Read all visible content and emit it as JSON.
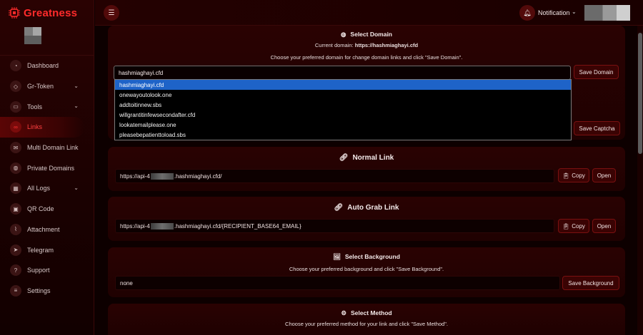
{
  "brand": {
    "name": "Greatness"
  },
  "topbar": {
    "notification_label": "Notification"
  },
  "sidebar": {
    "items": [
      {
        "label": "Dashboard",
        "icon": "dashboard-icon",
        "has_submenu": false,
        "active": false
      },
      {
        "label": "Gr-Token",
        "icon": "gem-icon",
        "has_submenu": true,
        "active": false
      },
      {
        "label": "Tools",
        "icon": "laptop-icon",
        "has_submenu": true,
        "active": false
      },
      {
        "label": "Links",
        "icon": "link-icon",
        "has_submenu": false,
        "active": true
      },
      {
        "label": "Multi Domain Link",
        "icon": "envelope-icon",
        "has_submenu": false,
        "active": false
      },
      {
        "label": "Private Domains",
        "icon": "globe-icon",
        "has_submenu": false,
        "active": false
      },
      {
        "label": "All Logs",
        "icon": "grid-icon",
        "has_submenu": true,
        "active": false
      },
      {
        "label": "QR Code",
        "icon": "qr-icon",
        "has_submenu": false,
        "active": false
      },
      {
        "label": "Attachment",
        "icon": "paperclip-icon",
        "has_submenu": false,
        "active": false
      },
      {
        "label": "Telegram",
        "icon": "telegram-icon",
        "has_submenu": false,
        "active": false
      },
      {
        "label": "Support",
        "icon": "question-icon",
        "has_submenu": false,
        "active": false
      },
      {
        "label": "Settings",
        "icon": "sliders-icon",
        "has_submenu": false,
        "active": false
      }
    ]
  },
  "select_domain": {
    "title": "Select Domain",
    "current_label": "Current domain:",
    "current_value": "https://hashmiaghayi.cfd",
    "instruction": "Choose your preferred domain for change domain links and click \"Save Domain\".",
    "selected": "hashmiaghayi.cfd",
    "options": [
      "hashmiaghayi.cfd",
      "onewayoutolook.one",
      "addtoitinnew.sbs",
      "willgrantitinfewsecondafter.cfd",
      "lookatemailplease.one",
      "pleasebepatienttoload.sbs"
    ],
    "save_label": "Save Domain",
    "save_captcha_label": "Save Captcha"
  },
  "normal_link": {
    "title": "Normal Link",
    "url_prefix": "https://api-4",
    "url_suffix": ".hashmiaghayi.cfd/",
    "copy_label": "Copy",
    "open_label": "Open"
  },
  "auto_grab_link": {
    "title": "Auto Grab Link",
    "url_prefix": "https://api-4",
    "url_suffix": ".hashmiaghayi.cfd/{RECIPIENT_BASE64_EMAIL}",
    "copy_label": "Copy",
    "open_label": "Open"
  },
  "select_background": {
    "title": "Select Background",
    "instruction": "Choose your preferred background and click \"Save Background\".",
    "value": "none",
    "save_label": "Save Background"
  },
  "select_method": {
    "title": "Select Method",
    "instruction": "Choose your preferred method for your link and click \"Save Method\"."
  },
  "colors": {
    "accent": "#ff2b2b",
    "background": "#0d0000",
    "card": "#250202",
    "dropdown_selected": "#1e63c8"
  }
}
